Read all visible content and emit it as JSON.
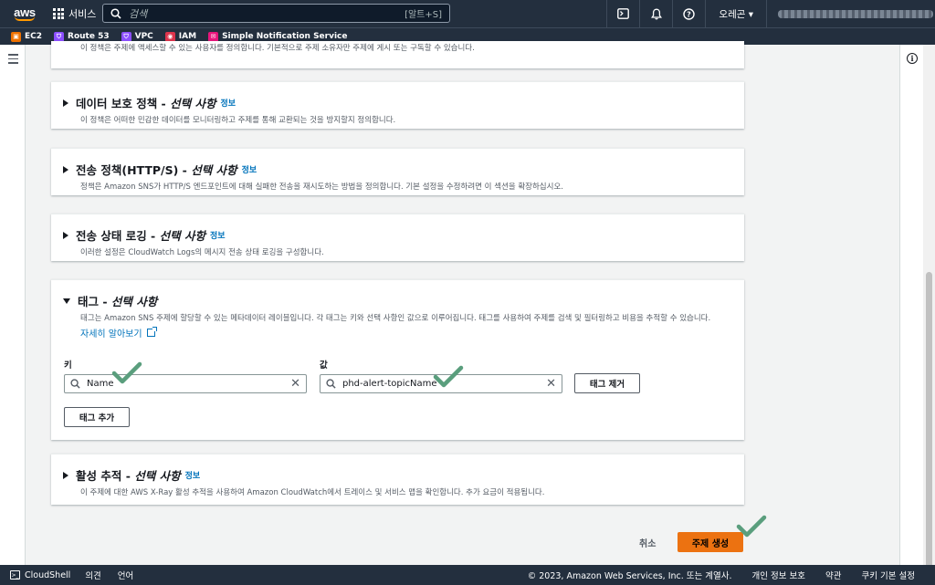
{
  "topnav": {
    "logo": "aws",
    "services_label": "서비스",
    "search_placeholder": "검색",
    "search_shortcut": "[알트+S]",
    "region_label": "오레곤 ▾",
    "icons": [
      "cloudshell-icon",
      "bell-icon",
      "help-icon"
    ]
  },
  "favorites": [
    {
      "label": "EC2",
      "color": "#ed7100",
      "glyph": "▣"
    },
    {
      "label": "Route 53",
      "color": "#8c4fff",
      "glyph": "⛉"
    },
    {
      "label": "VPC",
      "color": "#8c4fff",
      "glyph": "⛉"
    },
    {
      "label": "IAM",
      "color": "#dd344c",
      "glyph": "◉"
    },
    {
      "label": "Simple Notification Service",
      "color": "#e7157b",
      "glyph": "✉"
    }
  ],
  "top_panel_desc": "이 정책은 주제에 액세스할 수 있는 사용자를 정의합니다. 기본적으로 주제 소유자만 주제에 게시 또는 구독할 수 있습니다.",
  "panels": {
    "data_protection": {
      "title": "데이터 보호 정책 - ",
      "optional": "선택 사항",
      "info": "정보",
      "desc": "이 정책은 어떠한 민감한 데이터를 모니터링하고 주제를 통해 교환되는 것을 방지할지 정의합니다."
    },
    "delivery_policy": {
      "title": "전송 정책(HTTP/S) - ",
      "optional": "선택 사항",
      "info": "정보",
      "desc": "정책은 Amazon SNS가 HTTP/S 엔드포인트에 대해 실패한 전송을 재시도하는 방법을 정의합니다. 기본 설정을 수정하려면 이 섹션을 확장하십시오."
    },
    "delivery_logging": {
      "title": "전송 상태 로깅 - ",
      "optional": "선택 사항",
      "info": "정보",
      "desc": "이러한 설정은 CloudWatch Logs의 메시지 전송 상태 로깅을 구성합니다."
    },
    "tags": {
      "title": "태그 - ",
      "optional": "선택 사항",
      "desc": "태그는 Amazon SNS 주제에 할당할 수 있는 메타데이터 레이블입니다. 각 태그는 키와 선택 사항인 값으로 이루어집니다. 태그를 사용하여 주제를 검색 및 필터링하고 비용을 추적할 수 있습니다.",
      "learn_more": "자세히 알아보기",
      "key_label": "키",
      "value_label": "값",
      "key_value": "Name",
      "value_value": "phd-alert-topicName",
      "remove_button": "태그 제거",
      "add_button": "태그 추가"
    },
    "tracing": {
      "title": "활성 추적 - ",
      "optional": "선택 사항",
      "info": "정보",
      "desc": "이 주제에 대한 AWS X-Ray 활성 추적을 사용하여 Amazon CloudWatch에서 트레이스 및 서비스 맵을 확인합니다. 추가 요금이 적용됩니다."
    }
  },
  "actions": {
    "cancel": "취소",
    "create": "주제 생성"
  },
  "footer": {
    "cloudshell": "CloudShell",
    "feedback": "의견",
    "language": "언어",
    "copyright": "© 2023, Amazon Web Services, Inc. 또는 계열사.",
    "privacy": "개인 정보 보호",
    "terms": "약관",
    "cookies": "쿠키 기본 설정"
  },
  "colors": {
    "nav": "#232f3e",
    "primary": "#ec7211",
    "link": "#0073bb",
    "annotation_check": "#5a9e7d"
  }
}
